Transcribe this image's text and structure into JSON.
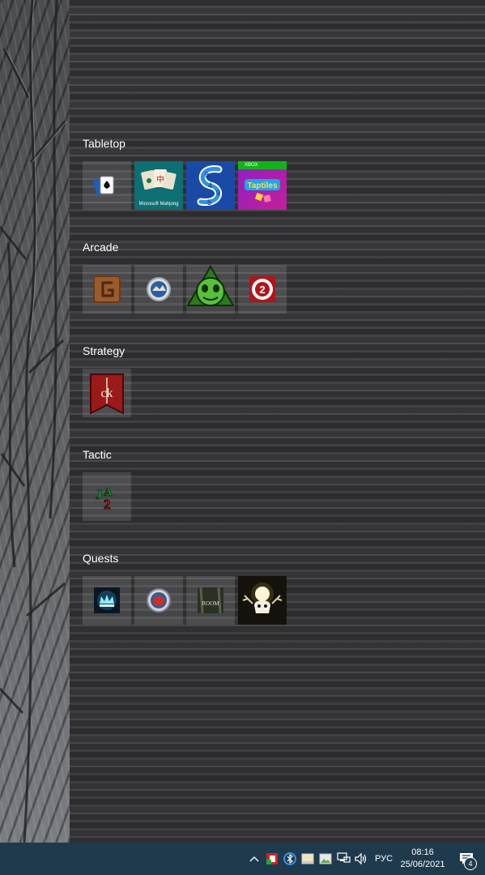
{
  "groups": [
    {
      "title": "Tabletop",
      "tiles": [
        {
          "icon": "solitaire-cards-icon"
        },
        {
          "icon": "microsoft-mahjong-icon",
          "caption": "Microsoft Mahjong"
        },
        {
          "icon": "sudoku-icon"
        },
        {
          "icon": "taptiles-icon",
          "badge": "XBOX",
          "brand": "Taptiles"
        }
      ]
    },
    {
      "title": "Arcade",
      "tiles": [
        {
          "icon": "wooden-g-game-icon"
        },
        {
          "icon": "pinball-orb-icon"
        },
        {
          "icon": "green-frog-icon"
        },
        {
          "icon": "casino-chip-2-icon",
          "label": "2"
        }
      ]
    },
    {
      "title": "Strategy",
      "tiles": [
        {
          "icon": "crusader-kings-banner-icon",
          "label": "ck"
        }
      ]
    },
    {
      "title": "Tactic",
      "tiles": [
        {
          "icon": "ja2-game-icon",
          "label": "JA2"
        }
      ]
    },
    {
      "title": "Quests",
      "tiles": [
        {
          "icon": "glowing-crown-icon"
        },
        {
          "icon": "shield-orb-icon"
        },
        {
          "icon": "the-room-icon",
          "label": "ROOM"
        },
        {
          "icon": "white-spirit-skull-icon"
        }
      ]
    }
  ],
  "taskbar": {
    "language": "РУС",
    "time": "08:16",
    "date": "25/06/2021",
    "notification_count": "4",
    "tray_icons": [
      "show-hidden-icons-chevron",
      "recording-app-icon",
      "bluetooth-arrow-icon",
      "window-app-icon",
      "image-app-icon",
      "network-icon",
      "volume-icon"
    ]
  }
}
